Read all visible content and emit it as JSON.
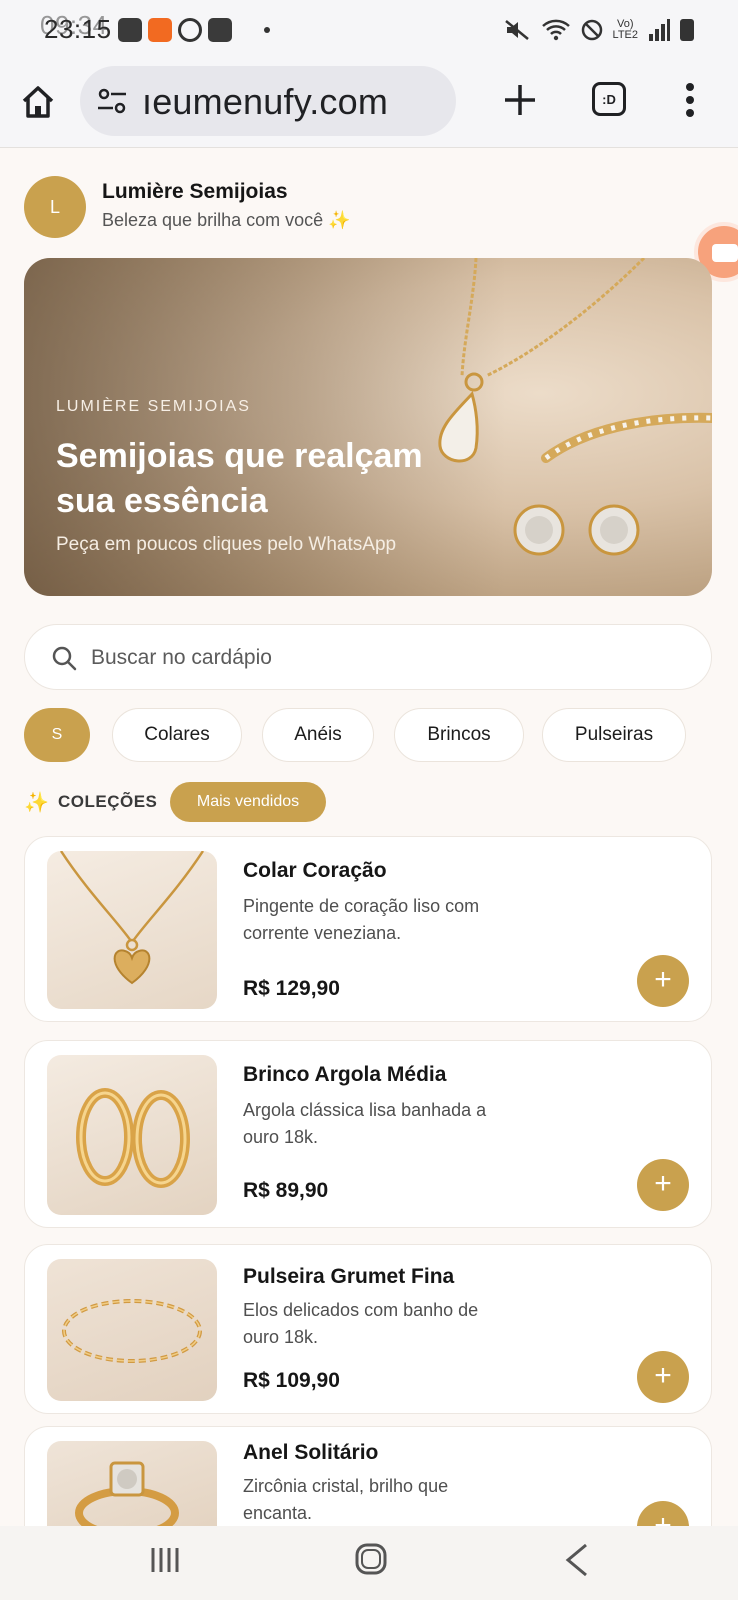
{
  "status_bar": {
    "time": "23:15",
    "time_ghost": "09:34"
  },
  "browser": {
    "url": "ıeumenufy.com",
    "tabs_label": ":D"
  },
  "header": {
    "logo_letter": "L",
    "store_name": "Lumière Semijoias",
    "tagline": "Beleza que brilha com você",
    "tagline_emoji": "✨"
  },
  "hero": {
    "eyebrow": "LUMIÈRE SEMIJOIAS",
    "title": "Semijoias que realçam sua essência",
    "subtitle": "Peça em poucos cliques pelo WhatsApp"
  },
  "search": {
    "placeholder": "Buscar no cardápio"
  },
  "categories": {
    "selected": "S",
    "items": [
      "Colares",
      "Anéis",
      "Brincos",
      "Pulseiras"
    ]
  },
  "collections": {
    "icon": "✨",
    "label": "COLEÇÕES",
    "active_chip": "Mais vendidos"
  },
  "products": [
    {
      "name": "Colar Coração",
      "description": "Pingente de coração liso com corrente veneziana.",
      "price": "R$ 129,90",
      "add": "+"
    },
    {
      "name": "Brinco Argola Média",
      "description": "Argola clássica lisa banhada a ouro 18k.",
      "price": "R$ 89,90",
      "add": "+"
    },
    {
      "name": "Pulseira Grumet Fina",
      "description": "Elos delicados com banho de ouro 18k.",
      "price": "R$ 109,90",
      "add": "+"
    },
    {
      "name": "Anel Solitário",
      "description": "Zircônia cristal, brilho que encanta.",
      "price": "",
      "add": "+"
    }
  ],
  "colors": {
    "accent": "#c9a14e",
    "background": "#fcf8f5",
    "card": "#ffffff"
  }
}
